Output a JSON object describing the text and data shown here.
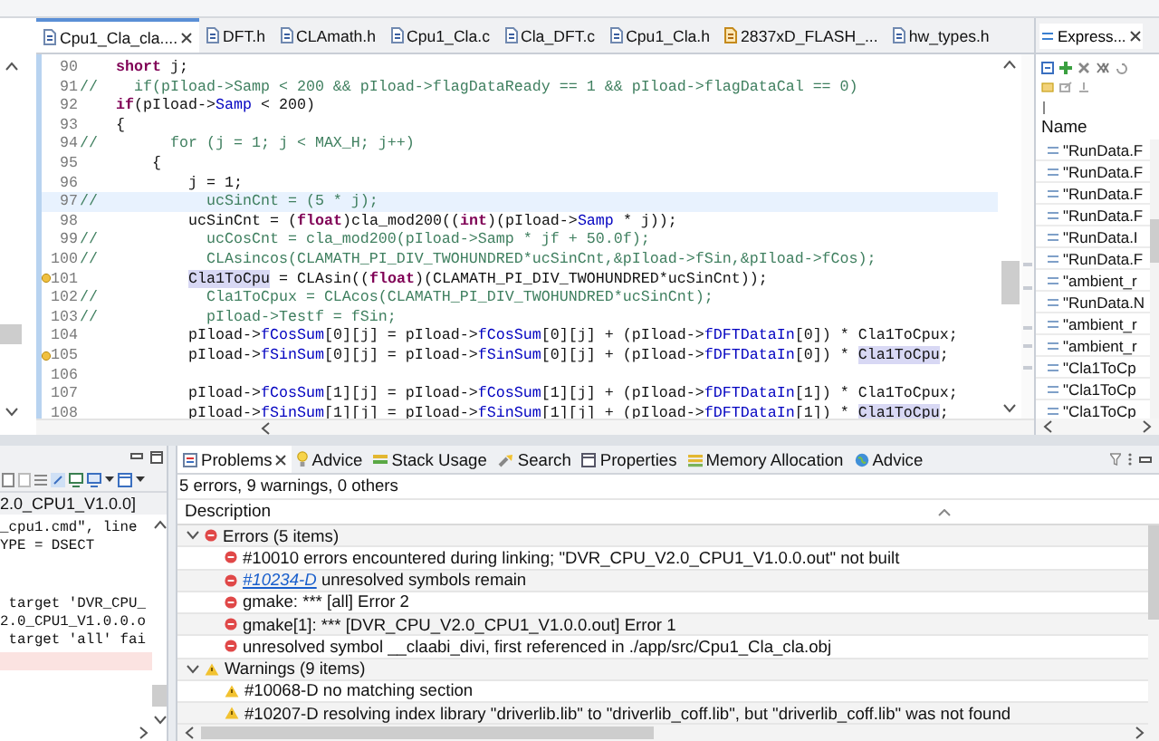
{
  "editor": {
    "tabs": [
      {
        "label": "Cpu1_Cla_cla....",
        "kind": "source",
        "selected": true
      },
      {
        "label": "DFT.h",
        "kind": "source",
        "selected": false
      },
      {
        "label": "CLAmath.h",
        "kind": "source",
        "selected": false
      },
      {
        "label": "Cpu1_Cla.c",
        "kind": "source",
        "selected": false
      },
      {
        "label": "Cla_DFT.c",
        "kind": "source",
        "selected": false
      },
      {
        "label": "Cpu1_Cla.h",
        "kind": "source",
        "selected": false
      },
      {
        "label": "2837xD_FLASH_...",
        "kind": "linker",
        "selected": false
      },
      {
        "label": "hw_types.h",
        "kind": "source",
        "selected": false
      }
    ],
    "lines": [
      {
        "number": "90",
        "current": false,
        "marker": false,
        "segments": [
          {
            "kind": "keyword",
            "text": "    short"
          },
          {
            "kind": "plain",
            "text": " j;"
          }
        ]
      },
      {
        "number": "91",
        "current": false,
        "marker": false,
        "segments": [
          {
            "kind": "comment",
            "text": "//    if(pIload->Samp < 200 && pIload->flagDataReady == 1 && pIload->flagDataCal == 0)"
          }
        ]
      },
      {
        "number": "92",
        "current": false,
        "marker": false,
        "segments": [
          {
            "kind": "keyword",
            "text": "    if"
          },
          {
            "kind": "plain",
            "text": "(pIload->"
          },
          {
            "kind": "field",
            "text": "Samp"
          },
          {
            "kind": "plain",
            "text": " < 200)"
          }
        ]
      },
      {
        "number": "93",
        "current": false,
        "marker": false,
        "segments": [
          {
            "kind": "plain",
            "text": "    {"
          }
        ]
      },
      {
        "number": "94",
        "current": false,
        "marker": false,
        "segments": [
          {
            "kind": "comment",
            "text": "//        for (j = 1; j < MAX_H; j++)"
          }
        ]
      },
      {
        "number": "95",
        "current": false,
        "marker": false,
        "segments": [
          {
            "kind": "plain",
            "text": "        {"
          }
        ]
      },
      {
        "number": "96",
        "current": false,
        "marker": false,
        "segments": [
          {
            "kind": "plain",
            "text": "            j = 1;"
          }
        ]
      },
      {
        "number": "97",
        "current": true,
        "marker": false,
        "segments": [
          {
            "kind": "comment",
            "text": "//            ucSinCnt = (5 * j);"
          }
        ]
      },
      {
        "number": "98",
        "current": false,
        "marker": false,
        "segments": [
          {
            "kind": "plain",
            "text": "            ucSinCnt = ("
          },
          {
            "kind": "keyword",
            "text": "float"
          },
          {
            "kind": "plain",
            "text": ")cla_mod200(("
          },
          {
            "kind": "keyword",
            "text": "int"
          },
          {
            "kind": "plain",
            "text": ")(pIload->"
          },
          {
            "kind": "field",
            "text": "Samp"
          },
          {
            "kind": "plain",
            "text": " * j));"
          }
        ]
      },
      {
        "number": "99",
        "current": false,
        "marker": false,
        "segments": [
          {
            "kind": "comment",
            "text": "//            ucCosCnt = cla_mod200(pIload->Samp * jf + 50.0f);"
          }
        ]
      },
      {
        "number": "100",
        "current": false,
        "marker": false,
        "segments": [
          {
            "kind": "comment",
            "text": "//            CLAsincos(CLAMATH_PI_DIV_TWOHUNDRED*ucSinCnt,&pIload->fSin,&pIload->fCos);"
          }
        ]
      },
      {
        "number": "101",
        "current": false,
        "marker": true,
        "segments": [
          {
            "kind": "occurrence",
            "text": "            Cla1ToCpu"
          },
          {
            "kind": "plain",
            "text": " = CLAsin(("
          },
          {
            "kind": "keyword",
            "text": "float"
          },
          {
            "kind": "plain",
            "text": ")(CLAMATH_PI_DIV_TWOHUNDRED*ucSinCnt));"
          }
        ]
      },
      {
        "number": "102",
        "current": false,
        "marker": false,
        "segments": [
          {
            "kind": "comment",
            "text": "//            Cla1ToCpux = CLAcos(CLAMATH_PI_DIV_TWOHUNDRED*ucSinCnt);"
          }
        ]
      },
      {
        "number": "103",
        "current": false,
        "marker": false,
        "segments": [
          {
            "kind": "comment",
            "text": "//            pIload->Testf = fSin;"
          }
        ]
      },
      {
        "number": "104",
        "current": false,
        "marker": false,
        "segments": [
          {
            "kind": "plain",
            "text": "            pIload->"
          },
          {
            "kind": "field",
            "text": "fCosSum"
          },
          {
            "kind": "plain",
            "text": "[0][j] = pIload->"
          },
          {
            "kind": "field",
            "text": "fCosSum"
          },
          {
            "kind": "plain",
            "text": "[0][j] + (pIload->"
          },
          {
            "kind": "field",
            "text": "fDFTDataIn"
          },
          {
            "kind": "plain",
            "text": "[0]) * Cla1ToCpux;"
          }
        ]
      },
      {
        "number": "105",
        "current": false,
        "marker": true,
        "segments": [
          {
            "kind": "plain",
            "text": "            pIload->"
          },
          {
            "kind": "field",
            "text": "fSinSum"
          },
          {
            "kind": "plain",
            "text": "[0][j] = pIload->"
          },
          {
            "kind": "field",
            "text": "fSinSum"
          },
          {
            "kind": "plain",
            "text": "[0][j] + (pIload->"
          },
          {
            "kind": "field",
            "text": "fDFTDataIn"
          },
          {
            "kind": "plain",
            "text": "[0]) * "
          },
          {
            "kind": "occurrence",
            "text": "Cla1ToCpu"
          },
          {
            "kind": "plain",
            "text": ";"
          }
        ]
      },
      {
        "number": "106",
        "current": false,
        "marker": false
      },
      {
        "number": "107",
        "current": false,
        "marker": false,
        "segments": [
          {
            "kind": "plain",
            "text": "            pIload->"
          },
          {
            "kind": "field",
            "text": "fCosSum"
          },
          {
            "kind": "plain",
            "text": "[1][j] = pIload->"
          },
          {
            "kind": "field",
            "text": "fCosSum"
          },
          {
            "kind": "plain",
            "text": "[1][j] + (pIload->"
          },
          {
            "kind": "field",
            "text": "fDFTDataIn"
          },
          {
            "kind": "plain",
            "text": "[1]) * Cla1ToCpux;"
          }
        ]
      },
      {
        "number": "108",
        "current": false,
        "marker": false,
        "segments": [
          {
            "kind": "plain",
            "text": "            pIload->"
          },
          {
            "kind": "field",
            "text": "fSinSum"
          },
          {
            "kind": "plain",
            "text": "[1][j] = pIload->"
          },
          {
            "kind": "field",
            "text": "fSinSum"
          },
          {
            "kind": "plain",
            "text": "[1][j] + (pIload->"
          },
          {
            "kind": "field",
            "text": "fDFTDataIn"
          },
          {
            "kind": "plain",
            "text": "[1]) * "
          },
          {
            "kind": "occurrence",
            "text": "Cla1ToCpu"
          },
          {
            "kind": "plain",
            "text": ";"
          }
        ]
      }
    ]
  },
  "expressions": {
    "tab": "Express...",
    "column": "Name",
    "rows": [
      "\"RunData.F",
      "\"RunData.F",
      "\"RunData.F",
      "\"RunData.F",
      "\"RunData.I",
      "\"RunData.F",
      "\"ambient_r",
      "\"RunData.N",
      "\"ambient_r",
      "\"ambient_r",
      "\"Cla1ToCp",
      "\"Cla1ToCp",
      "\"Cla1ToCp"
    ]
  },
  "console": {
    "title": "2.0_CPU1_V1.0.0]",
    "lines": [
      {
        "text": "_cpu1.cmd\", line",
        "highlighted": false
      },
      {
        "text": "YPE = DSECT",
        "highlighted": false
      },
      {
        "highlighted": false
      },
      {
        "highlighted": false
      },
      {
        "text": " target 'DVR_CPU_",
        "highlighted": false
      },
      {
        "text": "2.0_CPU1_V1.0.0.o",
        "highlighted": false
      },
      {
        "text": " target 'all' fai",
        "highlighted": false
      },
      {
        "highlighted": true
      }
    ]
  },
  "problems": {
    "tabs": [
      {
        "label": "Problems",
        "kind": "problems",
        "selected": true
      },
      {
        "label": "Advice",
        "kind": "advice",
        "selected": false
      },
      {
        "label": "Stack Usage",
        "kind": "stack",
        "selected": false
      },
      {
        "label": "Search",
        "kind": "search",
        "selected": false
      },
      {
        "label": "Properties",
        "kind": "properties",
        "selected": false
      },
      {
        "label": "Memory Allocation",
        "kind": "memory",
        "selected": false
      },
      {
        "label": "Advice",
        "kind": "web",
        "selected": false
      }
    ],
    "summary": "5 errors, 9 warnings, 0 others",
    "column": "Description",
    "groups": [
      {
        "label": "Errors (5 items)",
        "kind": "error",
        "expanded": true,
        "items": [
          {
            "text": "#10010 errors encountered during linking; \"DVR_CPU_V2.0_CPU1_V1.0.0.out\" not built"
          },
          {
            "link": "#10234-D",
            "text": "unresolved symbols remain"
          },
          {
            "text": "gmake: *** [all] Error 2"
          },
          {
            "text": "gmake[1]: *** [DVR_CPU_V2.0_CPU1_V1.0.0.out] Error 1"
          },
          {
            "text": "unresolved symbol __claabi_divi, first referenced in ./app/src/Cpu1_Cla_cla.obj"
          }
        ]
      },
      {
        "label": "Warnings (9 items)",
        "kind": "warning",
        "expanded": true,
        "items": [
          {
            "text": "#10068-D no matching section"
          },
          {
            "text": "#10207-D resolving index library \"driverlib.lib\" to \"driverlib_coff.lib\", but \"driverlib_coff.lib\" was not found"
          }
        ]
      }
    ]
  }
}
